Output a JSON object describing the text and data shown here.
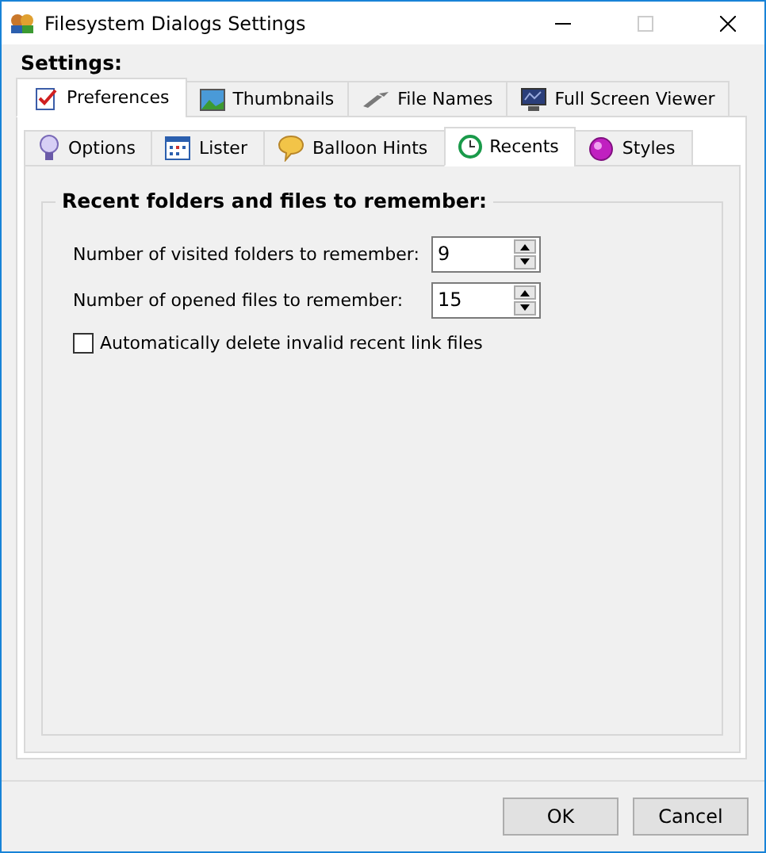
{
  "window": {
    "title": "Filesystem Dialogs Settings"
  },
  "settings_label": "Settings:",
  "outer_tabs": [
    {
      "label": "Preferences",
      "selected": true
    },
    {
      "label": "Thumbnails",
      "selected": false
    },
    {
      "label": "File Names",
      "selected": false
    },
    {
      "label": "Full Screen Viewer",
      "selected": false
    }
  ],
  "inner_tabs": [
    {
      "label": "Options",
      "selected": false
    },
    {
      "label": "Lister",
      "selected": false
    },
    {
      "label": "Balloon Hints",
      "selected": false
    },
    {
      "label": "Recents",
      "selected": true
    },
    {
      "label": "Styles",
      "selected": false
    }
  ],
  "group": {
    "title": "Recent folders and files to remember:",
    "spinners": [
      {
        "label": "Number of visited folders to remember:",
        "value": "9"
      },
      {
        "label": "Number of opened files to remember:",
        "value": "15"
      }
    ],
    "checkbox": {
      "label": "Automatically delete invalid recent link files",
      "checked": false
    }
  },
  "buttons": [
    "OK",
    "Cancel"
  ]
}
